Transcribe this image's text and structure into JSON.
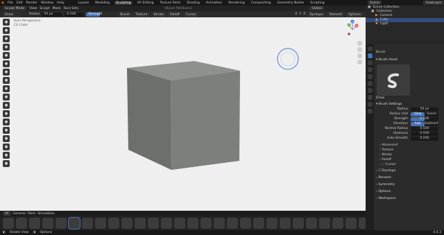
{
  "menu": {
    "items": [
      "File",
      "Edit",
      "Render",
      "Window",
      "Help"
    ]
  },
  "workspaces": {
    "tabs": [
      "Layout",
      "Modeling",
      "Sculpting",
      "UV Editing",
      "Texture Paint",
      "Shading",
      "Animation",
      "Rendering",
      "Compositing",
      "Geometry Nodes",
      "Scripting"
    ],
    "active": "Sculpting"
  },
  "header": {
    "mode": "Sculpt Mode",
    "view": "View",
    "sculpt": "Sculpt",
    "mask": "Mask",
    "face_sets": "Face Sets",
    "object_attributes": "Object Attributes",
    "global": "Global",
    "scene": "Scene",
    "view_layer": "ViewLayer"
  },
  "toolbar": {
    "brush": "Draw",
    "radius_label": "Radius",
    "radius_value": "50 px",
    "strength_label": "Strength",
    "strength_value": "0.500",
    "brush_menu": "Brush",
    "texture": "Texture",
    "stroke": "Stroke",
    "falloff": "Falloff",
    "cursor": "Cursor",
    "dyntopo": "Dyntopo",
    "remesh": "Remesh",
    "options": "Options",
    "x": "X",
    "y": "Y",
    "z": "Z"
  },
  "viewport": {
    "title": "User Perspective",
    "object": "(1) Cube",
    "colors": {
      "background": "#efefef",
      "cube_front": "#7c7f7c",
      "cube_top": "#8e918e",
      "cube_side": "#6c6f6c"
    },
    "gizmo": {
      "x": "X",
      "y": "Y",
      "z": "Z"
    }
  },
  "left_tools": [
    "draw-icon",
    "draw-sharp-icon",
    "clay-icon",
    "clay-strips-icon",
    "clay-thumb-icon",
    "layer-icon",
    "inflate-icon",
    "blob-icon",
    "crease-icon",
    "smooth-icon",
    "flatten-icon",
    "fill-icon",
    "scrape-icon",
    "multiplane-icon",
    "pinch-icon",
    "grab-icon",
    "elastic-icon",
    "snake-icon",
    "thumb-icon",
    "pose-icon",
    "nudge-icon",
    "rotate-icon",
    "slide-icon",
    "boundary-icon",
    "cloth-icon"
  ],
  "shelf": {
    "tabs": [
      "All",
      "General",
      "Paint",
      "Simulation"
    ],
    "brush_count": 34,
    "selected_index": 5
  },
  "status": {
    "rotate": "Rotate View",
    "options": "Options",
    "version": "4.4.3"
  },
  "outliner": {
    "title": "Scene Collection",
    "rows": [
      "Collection",
      "Camera",
      "Cube",
      "Light"
    ],
    "selected": "Cube"
  },
  "properties": {
    "brush_header": "Brush",
    "brush_asset": "Brush Asset",
    "brush_name": "Draw",
    "settings": "Brush Settings",
    "radius_label": "Radius",
    "radius_value": "50 px",
    "radius_unit_label": "Radius Unit",
    "radius_unit_view": "View",
    "radius_unit_scene": "Scene",
    "strength_label": "Strength",
    "strength_value": "0.500",
    "direction_label": "Direction",
    "direction_add": "Add",
    "direction_subtract": "Subtract",
    "normal_radius_label": "Normal Radius",
    "normal_radius_value": "0.500",
    "hardness_label": "Hardness",
    "hardness_value": "0.000",
    "autosmooth_label": "Auto-Smooth",
    "autosmooth_value": "0.000",
    "subsections": [
      "Advanced",
      "Texture",
      "Stroke",
      "Falloff",
      "Cursor"
    ],
    "panels": [
      "Dyntopo",
      "Remesh",
      "Symmetry",
      "Options",
      "Workspace"
    ]
  }
}
